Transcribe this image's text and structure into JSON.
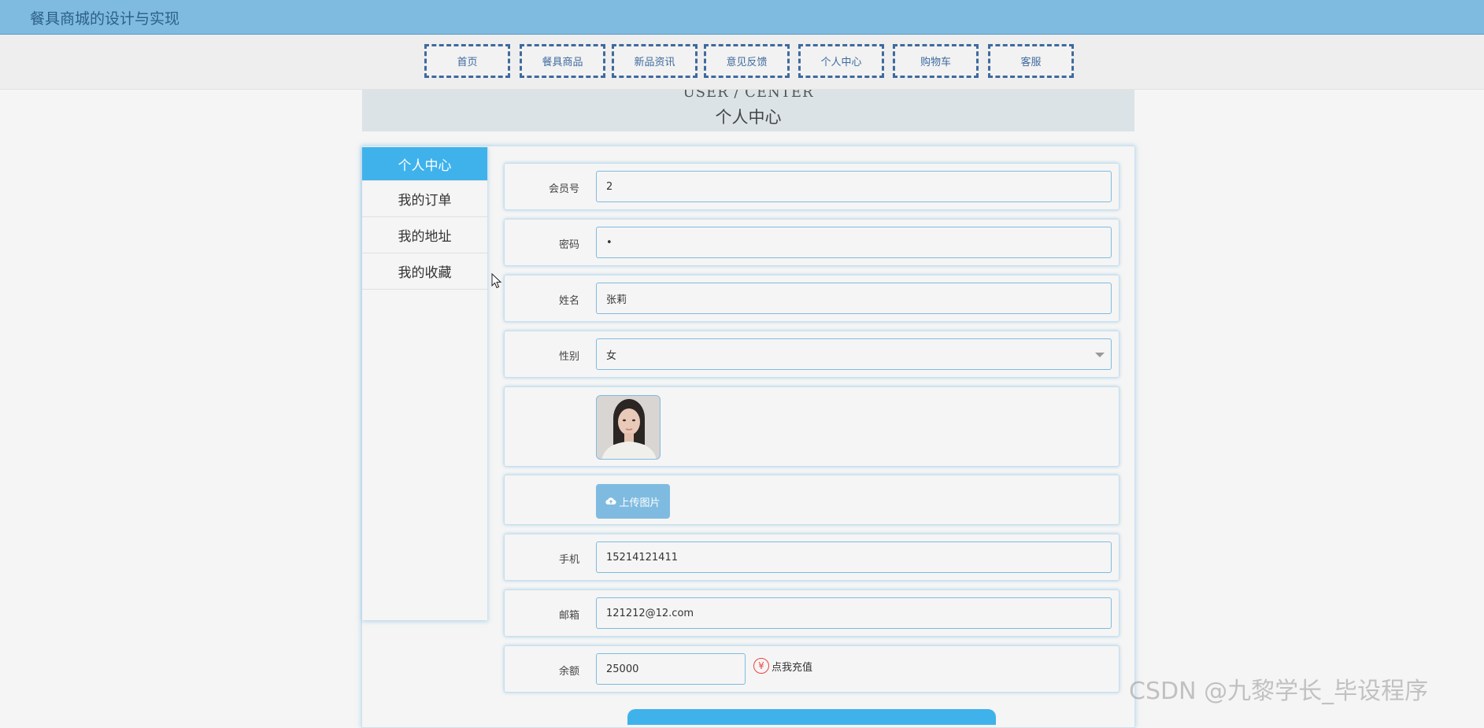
{
  "app": {
    "title": "餐具商城的设计与实现"
  },
  "nav": {
    "items": [
      "首页",
      "餐具商品",
      "新品资讯",
      "意见反馈",
      "个人中心",
      "购物车",
      "客服"
    ]
  },
  "heading": {
    "en": "USER / CENTER",
    "cn": "个人中心"
  },
  "sidebar": {
    "items": [
      "个人中心",
      "我的订单",
      "我的地址",
      "我的收藏"
    ],
    "active_index": 0
  },
  "form": {
    "member_no": {
      "label": "会员号",
      "value": "2"
    },
    "password": {
      "label": "密码",
      "value": "•"
    },
    "name": {
      "label": "姓名",
      "value": "张莉"
    },
    "gender": {
      "label": "性别",
      "value": "女"
    },
    "avatar": {
      "icon": "avatar-photo"
    },
    "upload": {
      "label": "上传图片",
      "icon": "cloud-upload-icon"
    },
    "phone": {
      "label": "手机",
      "value": "15214121411"
    },
    "email": {
      "label": "邮箱",
      "value": "121212@12.com"
    },
    "balance": {
      "label": "余额",
      "value": "25000",
      "recharge_label": "点我充值",
      "recharge_icon": "¥"
    }
  },
  "watermark": "CSDN @九黎学长_毕设程序",
  "colors": {
    "header": "#7fbbe0",
    "accent": "#3fb2ec",
    "nav_border": "#3e6a9e"
  }
}
